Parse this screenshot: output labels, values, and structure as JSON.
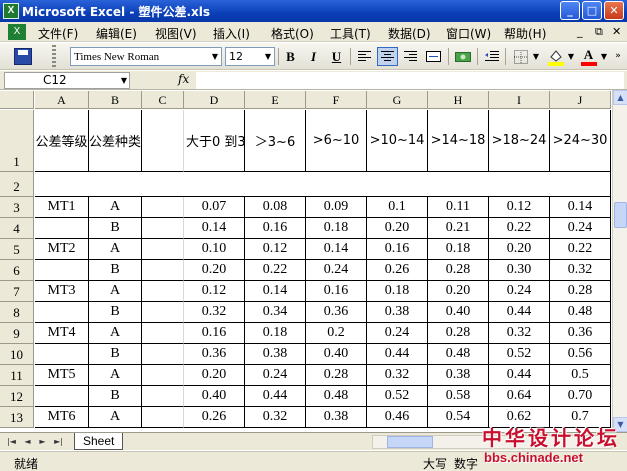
{
  "window": {
    "title": "Microsoft Excel - 塑件公差.xls",
    "app_icon": "X",
    "btn_minimize": "_",
    "btn_maximize": "□",
    "btn_close": "✕"
  },
  "menu": {
    "doc_icon": "X",
    "items": [
      "文件(F)",
      "编辑(E)",
      "视图(V)",
      "插入(I)",
      "格式(O)",
      "工具(T)",
      "数据(D)",
      "窗口(W)",
      "帮助(H)"
    ],
    "mdi_min": "_",
    "mdi_restore": "⧉",
    "mdi_close": "✕"
  },
  "toolbar": {
    "font_name": "Times New Roman",
    "font_size": "12",
    "bold": "B",
    "italic": "I",
    "underline": "U",
    "fill_color": "#ffff00",
    "font_color": "#ff0000",
    "font_color_label": "A"
  },
  "formula_bar": {
    "cell_ref": "C12",
    "fx": "fx",
    "content": ""
  },
  "sheet": {
    "columns": [
      "A",
      "B",
      "C",
      "D",
      "E",
      "F",
      "G",
      "H",
      "I",
      "J"
    ],
    "rows": [
      "1",
      "2",
      "3",
      "4",
      "5",
      "6",
      "7",
      "8",
      "9",
      "10",
      "11",
      "12",
      "13"
    ],
    "header_row": [
      "公差等级",
      "公差种类",
      "",
      "大于0 到3",
      "＞3~6",
      ">6~10",
      ">10~14",
      ">14~18",
      ">18~24",
      ">24~30"
    ],
    "data_rows": [
      [
        "MT1",
        "A",
        "",
        "0.07",
        "0.08",
        "0.09",
        "0.1",
        "0.11",
        "0.12",
        "0.14"
      ],
      [
        "",
        "B",
        "",
        "0.14",
        "0.16",
        "0.18",
        "0.20",
        "0.21",
        "0.22",
        "0.24"
      ],
      [
        "MT2",
        "A",
        "",
        "0.10",
        "0.12",
        "0.14",
        "0.16",
        "0.18",
        "0.20",
        "0.22"
      ],
      [
        "",
        "B",
        "",
        "0.20",
        "0.22",
        "0.24",
        "0.26",
        "0.28",
        "0.30",
        "0.32"
      ],
      [
        "MT3",
        "A",
        "",
        "0.12",
        "0.14",
        "0.16",
        "0.18",
        "0.20",
        "0.24",
        "0.28"
      ],
      [
        "",
        "B",
        "",
        "0.32",
        "0.34",
        "0.36",
        "0.38",
        "0.40",
        "0.44",
        "0.48"
      ],
      [
        "MT4",
        "A",
        "",
        "0.16",
        "0.18",
        "0.2",
        "0.24",
        "0.28",
        "0.32",
        "0.36"
      ],
      [
        "",
        "B",
        "",
        "0.36",
        "0.38",
        "0.40",
        "0.44",
        "0.48",
        "0.52",
        "0.56"
      ],
      [
        "MT5",
        "A",
        "",
        "0.20",
        "0.24",
        "0.28",
        "0.32",
        "0.38",
        "0.44",
        "0.5"
      ],
      [
        "",
        "B",
        "",
        "0.40",
        "0.44",
        "0.48",
        "0.52",
        "0.58",
        "0.64",
        "0.70"
      ],
      [
        "MT6",
        "A",
        "",
        "0.26",
        "0.32",
        "0.38",
        "0.46",
        "0.54",
        "0.62",
        "0.7"
      ]
    ]
  },
  "tabs": {
    "nav_first": "|◄",
    "nav_prev": "◄",
    "nav_next": "►",
    "nav_last": "►|",
    "sheet_name": "Sheet"
  },
  "status": {
    "ready": "就绪",
    "caps": "大写",
    "num": "数字"
  },
  "watermark": {
    "line1": "中华设计论坛",
    "line2": "bbs.chinade.net"
  }
}
